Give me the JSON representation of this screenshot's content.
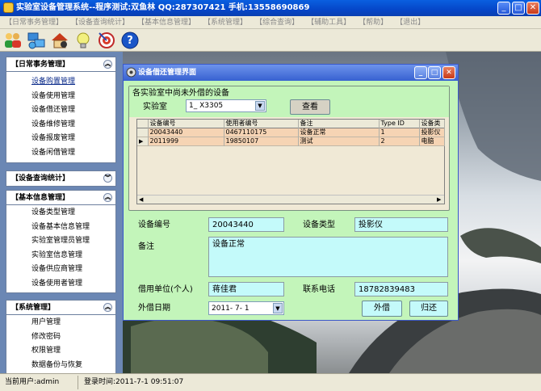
{
  "window": {
    "title": "实验室设备管理系统--程序测试:双鱼林 QQ:287307421 手机:13558690869"
  },
  "menubar": [
    "【日常事务管理】",
    "【设备查询统计】",
    "【基本信息管理】",
    "【系统管理】",
    "【综合查询】",
    "【辅助工具】",
    "【帮助】",
    "【退出】"
  ],
  "sidebar": {
    "daily": {
      "title": "【日常事务管理】",
      "items": [
        "设备购置管理",
        "设备使用管理",
        "设备借还管理",
        "设备维修管理",
        "设备报废管理",
        "设备闲借管理"
      ]
    },
    "query": {
      "title": "【设备查询统计】"
    },
    "basic": {
      "title": "【基本信息管理】",
      "items": [
        "设备类型管理",
        "设备基本信息管理",
        "实验室管理员管理",
        "实验室信息管理",
        "设备供应商管理",
        "设备使用者管理"
      ]
    },
    "system": {
      "title": "【系统管理】",
      "items": [
        "用户管理",
        "修改密码",
        "权限管理",
        "数据备份与恢复"
      ]
    }
  },
  "status": {
    "user": "当前用户:admin",
    "login": "登录时间:2011-7-1 09:51:07"
  },
  "dialog": {
    "title": "设备借还管理界面",
    "group": "各实验室中尚未外借的设备",
    "lab_label": "实验室",
    "lab_value": "1_ X3305",
    "query_button": "查看",
    "grid": {
      "columns": [
        "设备编号",
        "使用者编号",
        "备注",
        "Type ID",
        "设备类"
      ],
      "rows": [
        [
          "20043440",
          "0467110175",
          "设备正常",
          "1",
          "投影仪"
        ],
        [
          "2011999",
          "19850107",
          "测试",
          "2",
          "电脑"
        ]
      ]
    },
    "labels": {
      "device_no": "设备编号",
      "device_type": "设备类型",
      "remark": "备注",
      "borrower": "借用单位(个人)",
      "phone": "联系电话",
      "date": "外借日期"
    },
    "values": {
      "device_no": "20043440",
      "device_type": "投影仪",
      "remark": "设备正常",
      "borrower": "蒋佳君",
      "phone": "18782839483",
      "date": "2011- 7- 1"
    },
    "buttons": {
      "lend": "外借",
      "return": "归还"
    }
  }
}
